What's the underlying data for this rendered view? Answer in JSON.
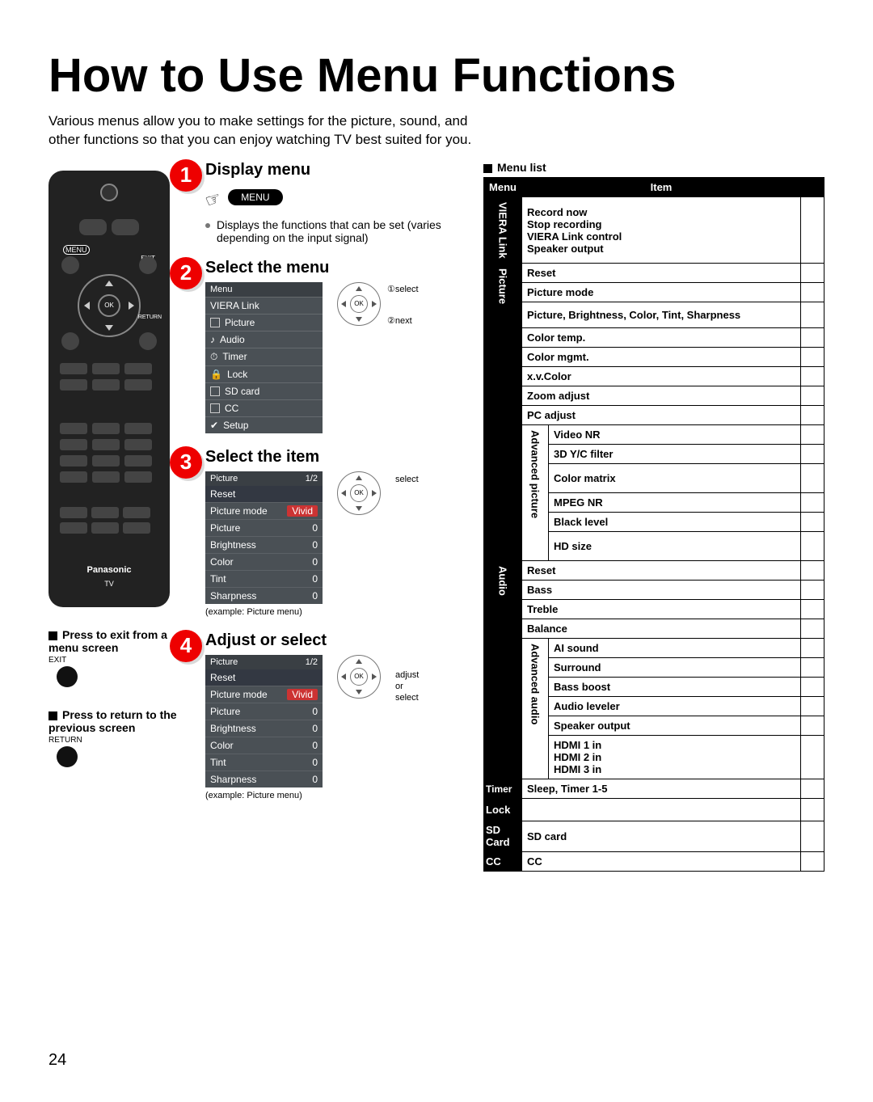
{
  "title": "How to Use Menu Functions",
  "intro": "Various menus allow you to make settings for the picture, sound, and other functions so that you can enjoy watching TV best suited for you.",
  "page_number": "24",
  "remote": {
    "menu_label": "MENU",
    "exit_label": "EXIT",
    "ok_label": "OK",
    "return_label": "RETURN",
    "brand": "Panasonic",
    "tv": "TV"
  },
  "notes": {
    "exit": {
      "heading": "Press to exit from a menu screen",
      "label": "EXIT"
    },
    "return": {
      "heading": "Press to return to the previous screen",
      "label": "RETURN"
    }
  },
  "steps": {
    "s1": {
      "title": "Display menu",
      "pill": "MENU",
      "desc": "Displays the functions that can be set (varies depending on the input signal)"
    },
    "s2": {
      "title": "Select the menu",
      "ann1": "①select",
      "ann2": "②next",
      "menu": {
        "header": "Menu",
        "items": [
          "VIERA Link",
          "Picture",
          "Audio",
          "Timer",
          "Lock",
          "SD card",
          "CC",
          "Setup"
        ]
      },
      "ok": "OK"
    },
    "s3": {
      "title": "Select the item",
      "ann": "select",
      "ok": "OK",
      "caption": "(example:  Picture menu)",
      "osd": {
        "header": "Picture",
        "page": "1/2",
        "reset": "Reset",
        "rows": [
          {
            "k": "Picture mode",
            "v": "Vivid",
            "red": true
          },
          {
            "k": "Picture",
            "v": "0"
          },
          {
            "k": "Brightness",
            "v": "0"
          },
          {
            "k": "Color",
            "v": "0"
          },
          {
            "k": "Tint",
            "v": "0"
          },
          {
            "k": "Sharpness",
            "v": "0"
          }
        ]
      }
    },
    "s4": {
      "title": "Adjust or select",
      "ann": "adjust or select",
      "ok": "OK",
      "caption": "(example:  Picture menu)",
      "osd": {
        "header": "Picture",
        "page": "1/2",
        "reset": "Reset",
        "rows": [
          {
            "k": "Picture mode",
            "v": "Vivid",
            "red": true
          },
          {
            "k": "Picture",
            "v": "0"
          },
          {
            "k": "Brightness",
            "v": "0"
          },
          {
            "k": "Color",
            "v": "0"
          },
          {
            "k": "Tint",
            "v": "0"
          },
          {
            "k": "Sharpness",
            "v": "0"
          }
        ]
      }
    }
  },
  "menulist": {
    "title": "Menu list",
    "col_menu": "Menu",
    "col_item": "Item",
    "viera": {
      "label": "VIERA Link",
      "items": "Record now\nStop recording\nVIERA Link control\nSpeaker output"
    },
    "picture": {
      "label": "Picture",
      "rows": [
        "Reset",
        "Picture mode",
        "Picture, Brightness, Color, Tint, Sharpness",
        "Color temp.",
        "Color mgmt.",
        "x.v.Color",
        "Zoom adjust",
        "PC adjust"
      ],
      "adv_label": "Advanced picture",
      "adv": [
        "Video NR",
        "3D Y/C filter",
        "Color matrix",
        "MPEG NR",
        "Black level",
        "HD size"
      ]
    },
    "audio": {
      "label": "Audio",
      "rows": [
        "Reset",
        "Bass",
        "Treble",
        "Balance"
      ],
      "adv_label": "Advanced audio",
      "adv": [
        "AI sound",
        "Surround",
        "Bass boost",
        "Audio leveler",
        "Speaker output",
        "HDMI 1 in\nHDMI 2 in\nHDMI 3 in"
      ]
    },
    "timer": {
      "label": "Timer",
      "item": "Sleep, Timer 1-5"
    },
    "lock": {
      "label": "Lock",
      "item": ""
    },
    "sd": {
      "label": "SD Card",
      "item": "SD card"
    },
    "cc": {
      "label": "CC",
      "item": "CC"
    }
  }
}
